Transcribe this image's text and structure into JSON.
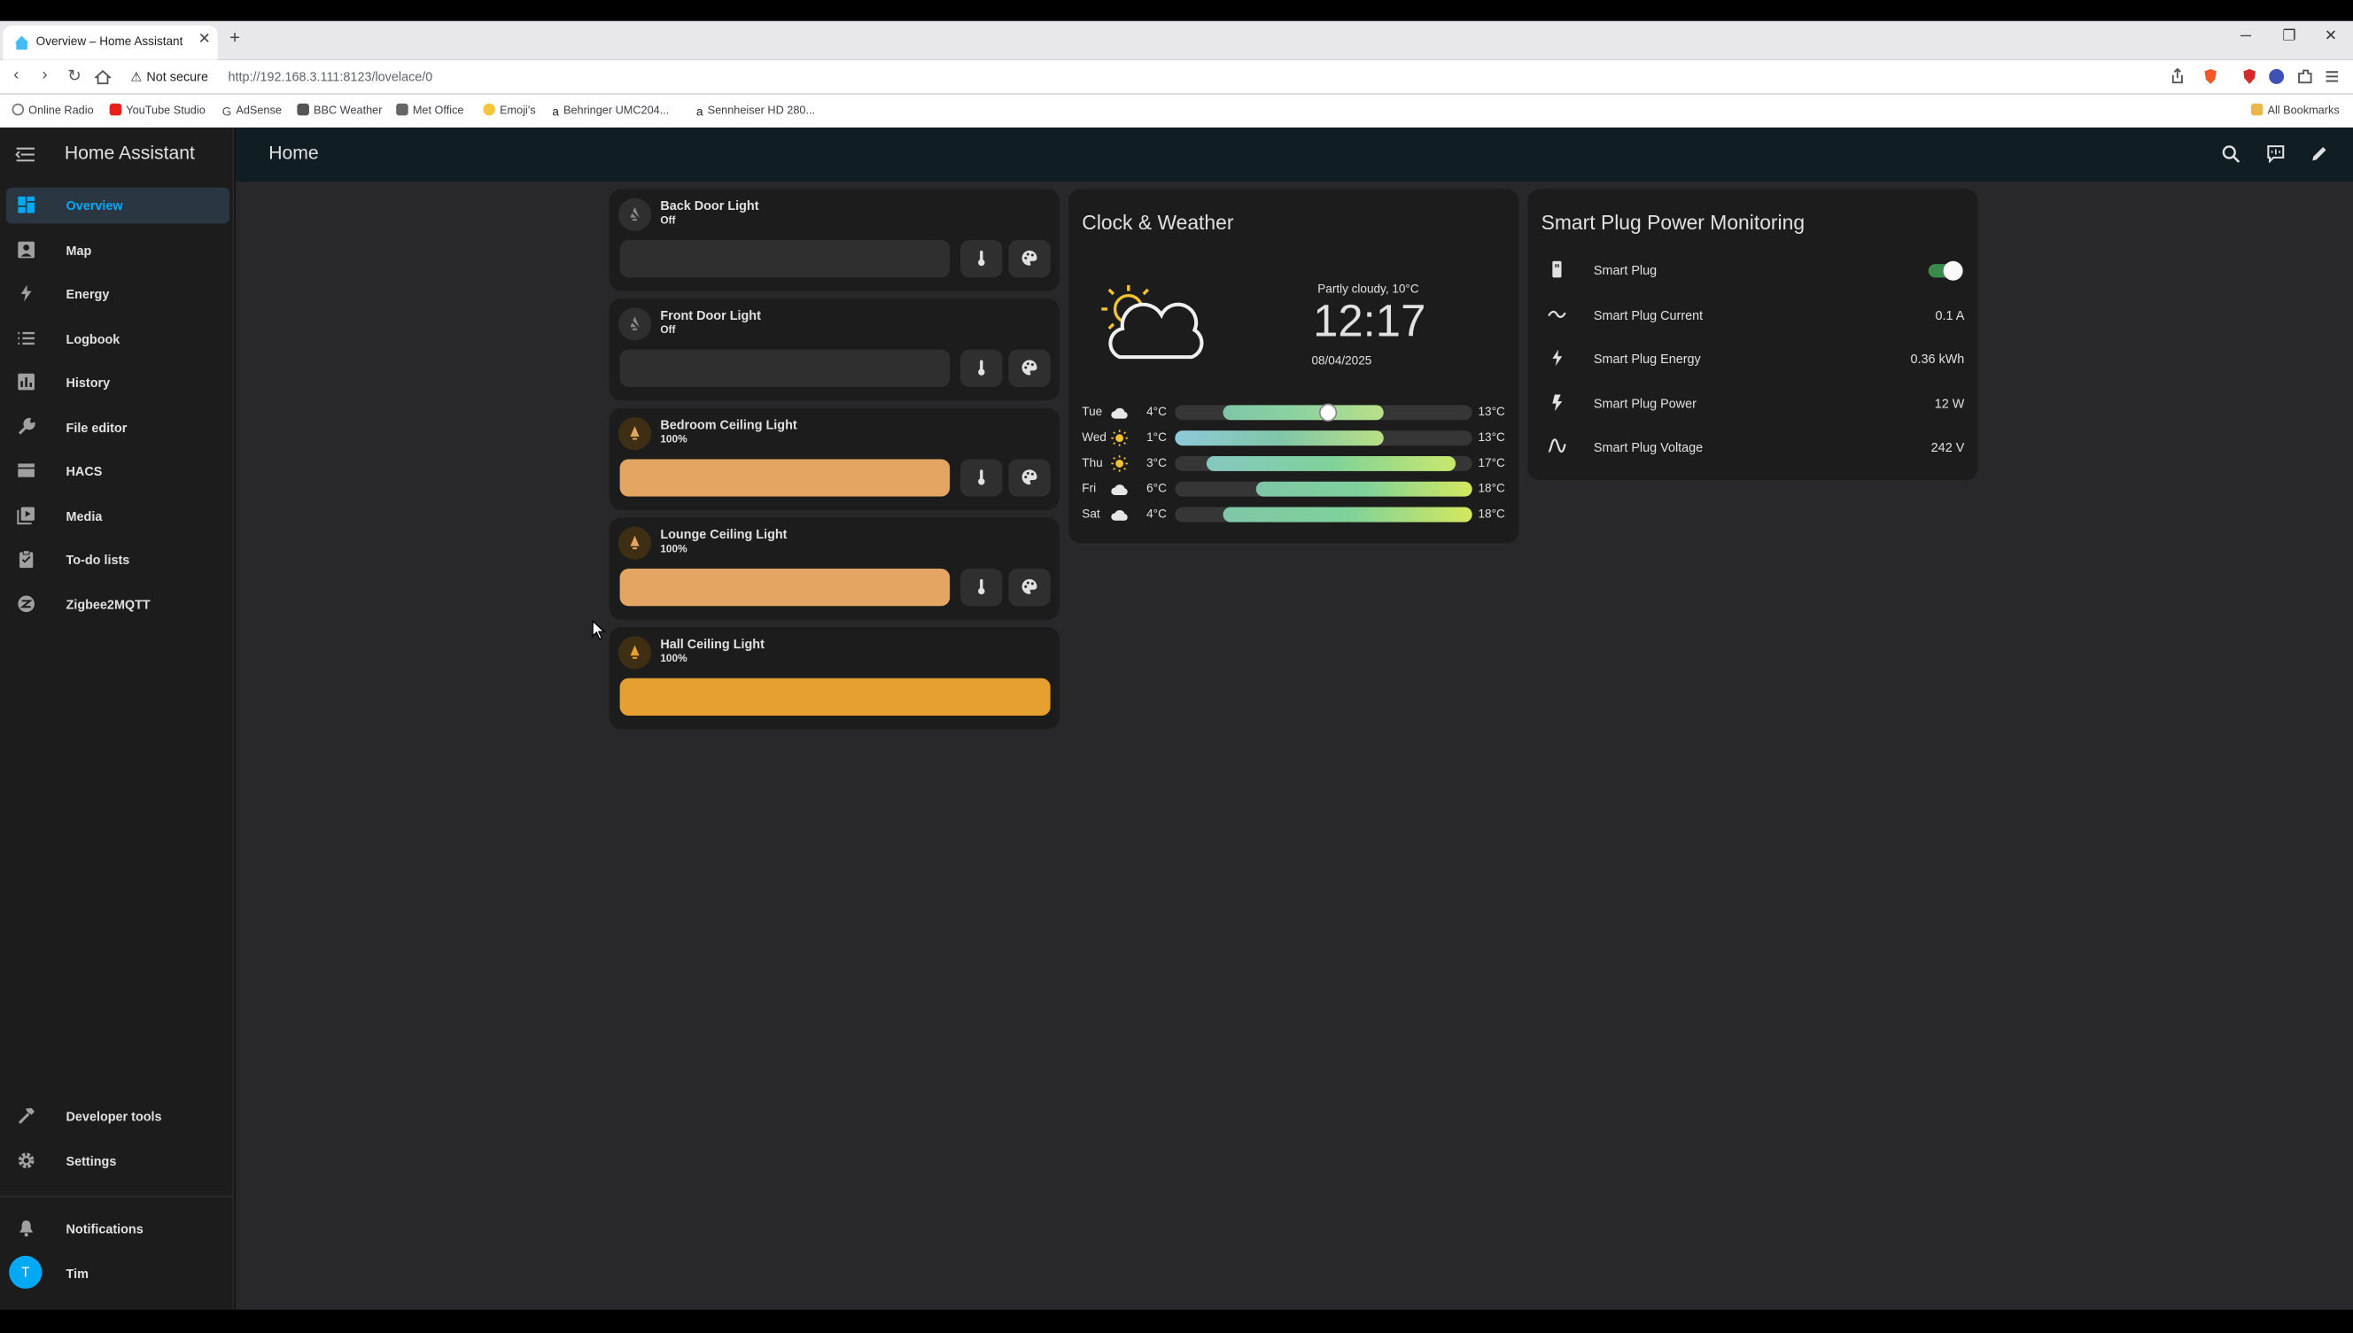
{
  "browser": {
    "tab_title": "Overview – Home Assistant",
    "security_label": "Not secure",
    "url": "http://192.168.3.111:8123/lovelace/0",
    "bookmarks": [
      "Online Radio",
      "YouTube Studio",
      "AdSense",
      "BBC Weather",
      "Met Office",
      "Emoji's",
      "Behringer UMC204...",
      "Sennheiser HD 280..."
    ],
    "all_bookmarks": "All Bookmarks"
  },
  "sidebar": {
    "title": "Home Assistant",
    "items": [
      {
        "label": "Overview",
        "icon": "grid-icon"
      },
      {
        "label": "Map",
        "icon": "map-icon"
      },
      {
        "label": "Energy",
        "icon": "lightning-icon"
      },
      {
        "label": "Logbook",
        "icon": "list-icon"
      },
      {
        "label": "History",
        "icon": "chart-icon"
      },
      {
        "label": "File editor",
        "icon": "wrench-icon"
      },
      {
        "label": "HACS",
        "icon": "hacs-icon"
      },
      {
        "label": "Media",
        "icon": "media-icon"
      },
      {
        "label": "To-do lists",
        "icon": "clipboard-icon"
      },
      {
        "label": "Zigbee2MQTT",
        "icon": "zigbee-icon"
      }
    ],
    "bottom_items": [
      {
        "label": "Developer tools",
        "icon": "hammer-icon"
      },
      {
        "label": "Settings",
        "icon": "gear-icon"
      },
      {
        "label": "Notifications",
        "icon": "bell-icon"
      }
    ],
    "user": {
      "initial": "T",
      "name": "Tim"
    }
  },
  "header": {
    "title": "Home"
  },
  "lights": [
    {
      "name": "Back Door Light",
      "state": "Off",
      "brightness": 0,
      "on": false
    },
    {
      "name": "Front Door Light",
      "state": "Off",
      "brightness": 0,
      "on": false
    },
    {
      "name": "Bedroom Ceiling Light",
      "state": "100%",
      "brightness": 100,
      "on": true
    },
    {
      "name": "Lounge Ceiling Light",
      "state": "100%",
      "brightness": 100,
      "on": true
    },
    {
      "name": "Hall Ceiling Light",
      "state": "100%",
      "brightness": 100,
      "on": true
    }
  ],
  "weather": {
    "title": "Clock & Weather",
    "condition": "Partly cloudy, 10°C",
    "time": "12:17",
    "date": "08/04/2025",
    "forecast": [
      {
        "day": "Tue",
        "icon": "cloudy-icon",
        "low": "4°C",
        "high": "13°C"
      },
      {
        "day": "Wed",
        "icon": "sunny-icon",
        "low": "1°C",
        "high": "13°C"
      },
      {
        "day": "Thu",
        "icon": "sunny-icon",
        "low": "3°C",
        "high": "17°C"
      },
      {
        "day": "Fri",
        "icon": "cloudy-icon",
        "low": "6°C",
        "high": "18°C"
      },
      {
        "day": "Sat",
        "icon": "cloudy-icon",
        "low": "4°C",
        "high": "18°C"
      }
    ]
  },
  "plug": {
    "title": "Smart Plug Power Monitoring",
    "rows": [
      {
        "name": "Smart Plug",
        "value": "",
        "icon": "plug-icon",
        "toggle": true
      },
      {
        "name": "Smart Plug Current",
        "value": "0.1 A",
        "icon": "current-icon"
      },
      {
        "name": "Smart Plug Energy",
        "value": "0.36 kWh",
        "icon": "lightning-icon"
      },
      {
        "name": "Smart Plug Power",
        "value": "12 W",
        "icon": "flash-icon"
      },
      {
        "name": "Smart Plug Voltage",
        "value": "242 V",
        "icon": "sine-wave-icon"
      }
    ]
  },
  "colors": {
    "accent": "#03a9f4",
    "light_on": "#e4a563",
    "hall_light": "#e5a02f",
    "toggle_on": "#3a8b4a"
  }
}
